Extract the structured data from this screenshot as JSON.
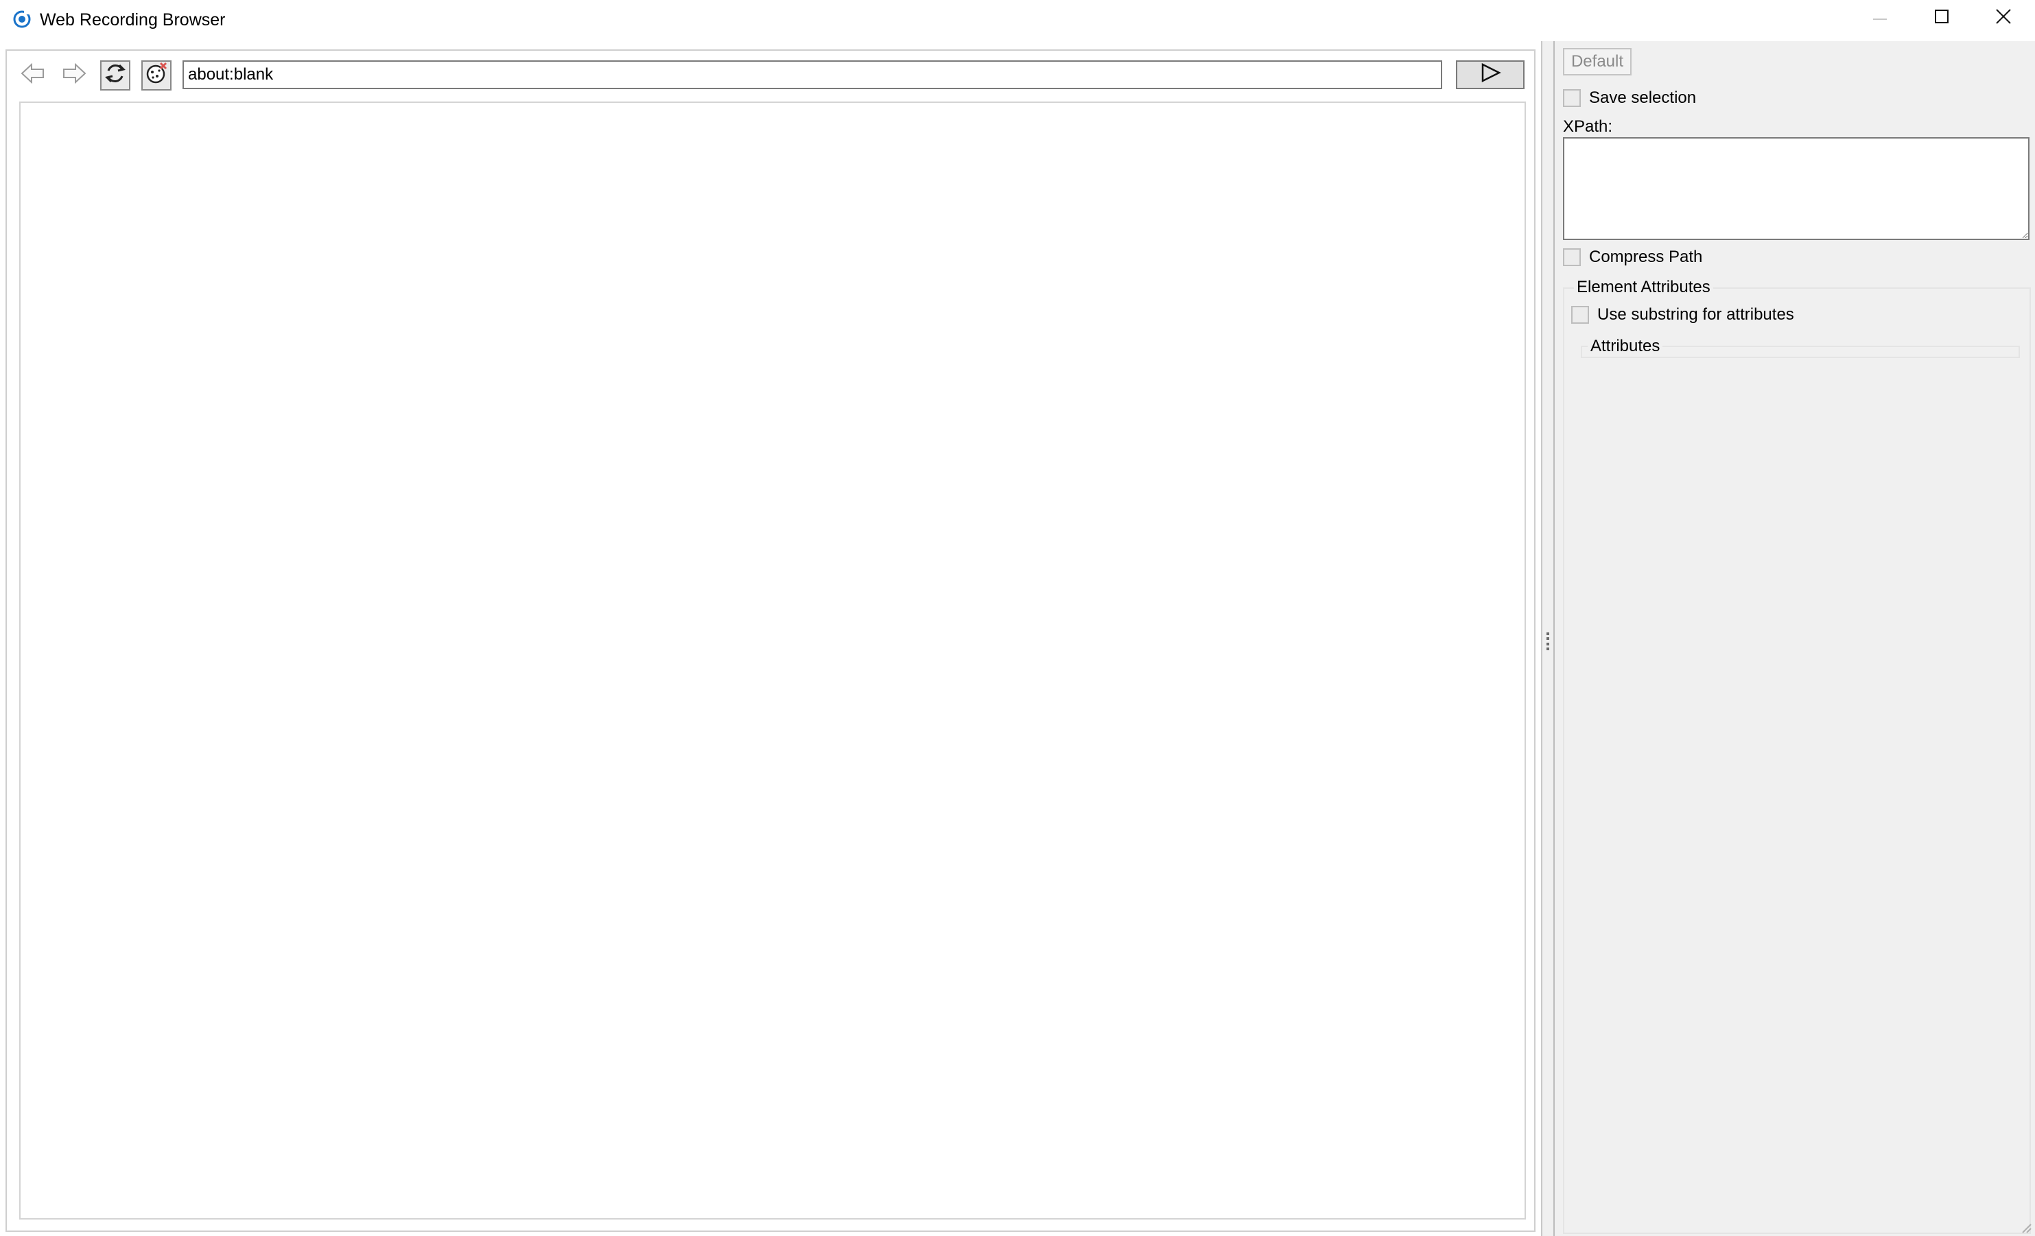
{
  "window": {
    "title": "Web Recording Browser",
    "controls": {
      "minimize": "minimize",
      "maximize": "maximize",
      "close": "close"
    }
  },
  "browser": {
    "nav_icons": [
      "back-arrow-icon",
      "forward-arrow-icon",
      "refresh-icon",
      "clear-cookies-icon"
    ],
    "url": "about:blank",
    "go_icon": "play-triangle-icon"
  },
  "panel": {
    "default_label": "Default",
    "save_selection_label": "Save selection",
    "save_selection_checked": false,
    "xpath_label": "XPath:",
    "xpath_value": "",
    "compress_path_label": "Compress Path",
    "compress_path_checked": false,
    "element_attributes_label": "Element Attributes",
    "use_substring_label": "Use substring for attributes",
    "use_substring_checked": false,
    "attributes_label": "Attributes"
  },
  "colors": {
    "accent": "#1a73c9",
    "panel_bg": "#f0f0f0",
    "cookie_x": "#d9534f"
  }
}
